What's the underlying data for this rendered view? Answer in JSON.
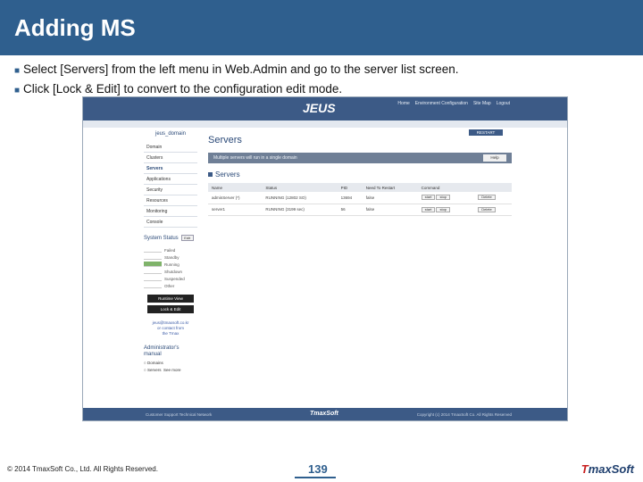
{
  "slide": {
    "title": "Adding MS",
    "bullets": [
      "Select [Servers] from the left menu in Web.Admin and go to the server list screen.",
      "Click [Lock & Edit] to convert to the configuration edit mode."
    ],
    "copyright": "© 2014 TmaxSoft Co., Ltd. All Rights Reserved.",
    "page_number": "139",
    "brand": "TmaxSoft"
  },
  "colors": {
    "header": "#2f5f8e",
    "webadmin_bar": "#3c5a86",
    "running": "#7fb36a"
  },
  "webadmin": {
    "logo": "JEUS",
    "nav": [
      "Home",
      "Environment Configuration",
      "Site Map",
      "Logout"
    ],
    "domain_label": "jeus_domain",
    "menu": [
      "Domain",
      "Clusters",
      "Servers",
      "Applications",
      "Security",
      "Resources",
      "Monitoring",
      "Console"
    ],
    "system_status": {
      "title": "System Status",
      "button": "Edit"
    },
    "status_list": [
      "Failed",
      "Standby",
      "Running",
      "Shutdown",
      "Suspended",
      "Other"
    ],
    "buttons": {
      "runtime_view": "Runtime View",
      "lock_edit": "Lock & Edit",
      "restart": "RESTART",
      "help": "Help"
    },
    "contact": [
      "jeus@tmaxsoft.co.kr",
      "or contact from",
      "the Tmax"
    ],
    "admin_manual": {
      "title": "Administrator's manual",
      "options": [
        "Domains",
        "Servers"
      ],
      "more": "See more"
    },
    "page_title": "Servers",
    "info_message": "Multiple servers will run in a single domain",
    "section_title": "Servers",
    "table": {
      "columns": [
        "Name",
        "Status",
        "PID",
        "Need To Restart",
        "Command"
      ],
      "rows": [
        {
          "name": "adminServer (*)",
          "status": "RUNNING (12802 SO)",
          "pid": "13694",
          "restart": "false",
          "start": "start",
          "stop": "stop",
          "action": "Delete"
        },
        {
          "name": "server1",
          "status": "RUNNING (3199 sec)",
          "pid": "56",
          "restart": "false",
          "start": "start",
          "stop": "stop",
          "action": "Delete"
        }
      ]
    },
    "footer": {
      "left": "Customer Support    Technical Network",
      "center": "TmaxSoft",
      "right": "Copyright (c) 2014 TmaxSoft Co. All Rights Reserved"
    }
  }
}
